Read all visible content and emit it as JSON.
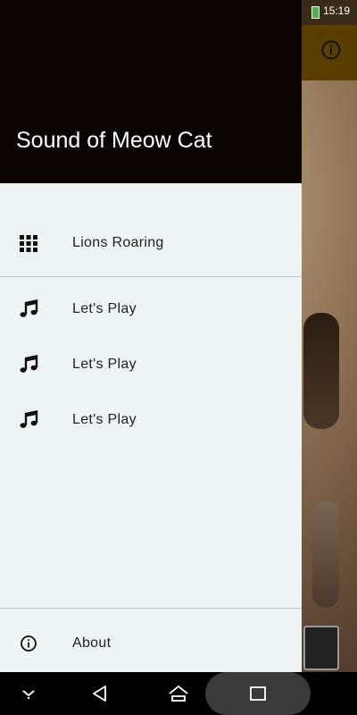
{
  "status_bar": {
    "time": "15:19"
  },
  "drawer": {
    "title": "Sound of Meow Cat",
    "items": [
      {
        "label": "Lions Roaring",
        "icon": "grid-icon"
      },
      {
        "label": "Let's Play",
        "icon": "music-note-icon"
      },
      {
        "label": "Let's Play",
        "icon": "music-note-icon"
      },
      {
        "label": "Let's Play",
        "icon": "music-note-icon"
      }
    ],
    "footer_item": {
      "label": "About",
      "icon": "info-icon"
    }
  },
  "navigation": {
    "icons": [
      "chevron-down-icon",
      "back-icon",
      "home-icon",
      "recents-icon"
    ]
  }
}
